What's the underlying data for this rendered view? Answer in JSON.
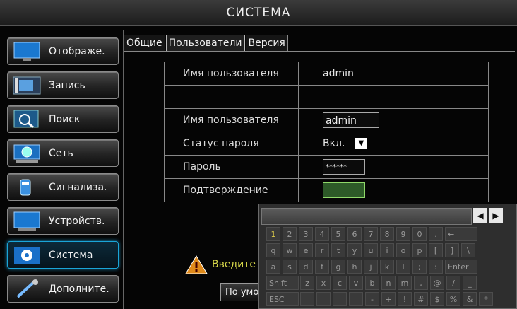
{
  "window": {
    "title": "СИСТЕМА"
  },
  "sidebar": {
    "items": [
      {
        "label": "Отображе.",
        "icon": "monitor-icon",
        "active": false
      },
      {
        "label": "Запись",
        "icon": "film-icon",
        "active": false
      },
      {
        "label": "Поиск",
        "icon": "search-icon",
        "active": false
      },
      {
        "label": "Сеть",
        "icon": "network-icon",
        "active": false
      },
      {
        "label": "Сигнализа.",
        "icon": "alarm-icon",
        "active": false
      },
      {
        "label": "Устройств.",
        "icon": "device-icon",
        "active": false
      },
      {
        "label": "Система",
        "icon": "gear-icon",
        "active": true
      },
      {
        "label": "Дополните.",
        "icon": "wrench-icon",
        "active": false
      }
    ]
  },
  "tabs": [
    {
      "label": "Общие",
      "active": false
    },
    {
      "label": "Пользователи",
      "active": true
    },
    {
      "label": "Версия",
      "active": false
    }
  ],
  "form": {
    "username_label": "Имя пользователя",
    "username_value": "admin",
    "username2_label": "Имя пользователя",
    "username2_value": "admin",
    "pwd_status_label": "Статус пароля",
    "pwd_status_value": "Вкл.",
    "password_label": "Пароль",
    "password_value": "******",
    "confirm_label": "Подтверждение",
    "confirm_value": ""
  },
  "warning": {
    "text": "Введите"
  },
  "buttons": {
    "default_label": "По умо"
  },
  "keyboard": {
    "rows": [
      [
        "1",
        "2",
        "3",
        "4",
        "5",
        "6",
        "7",
        "8",
        "9",
        "0",
        ".",
        "←"
      ],
      [
        "q",
        "w",
        "e",
        "r",
        "t",
        "y",
        "u",
        "i",
        "o",
        "p",
        "[",
        "]",
        "\\"
      ],
      [
        "a",
        "s",
        "d",
        "f",
        "g",
        "h",
        "j",
        "k",
        "l",
        ";",
        ":",
        "Enter"
      ],
      [
        "Shift",
        "z",
        "x",
        "c",
        "v",
        "b",
        "n",
        "m",
        ",",
        "@",
        "/",
        "_"
      ],
      [
        "ESC",
        "",
        "",
        "",
        "",
        "-",
        "+",
        "!",
        "#",
        "$",
        "%",
        "&",
        "*"
      ]
    ]
  },
  "colors": {
    "accent": "#1aa5d8",
    "warn": "#d8d84a",
    "confirm_field": "#2d5a28"
  }
}
